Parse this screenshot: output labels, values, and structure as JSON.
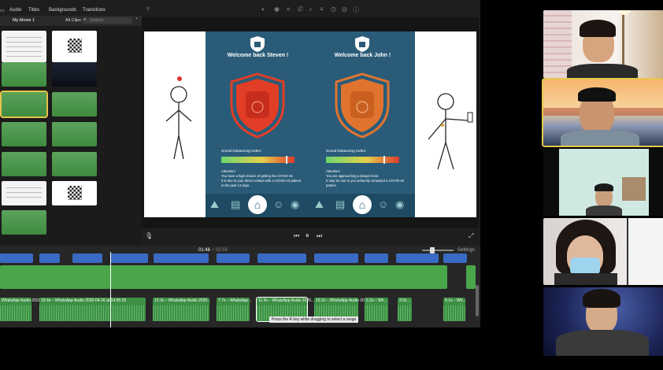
{
  "editor": {
    "tabs": [
      "Audio",
      "Titles",
      "Backgrounds",
      "Transitions"
    ],
    "library": {
      "project": "My Movie 1",
      "filter": "All Clips",
      "search_placeholder": "Search"
    },
    "viewer": {
      "screens": [
        {
          "greeting": "Welcome back Steven !",
          "sdi_label": "Social Distancing Index:",
          "note": "Attention!\nYou have a high chance of getting the COVID-19.\nIt is due to your direct contact with a COVID-19 patient in the past 14 days.",
          "shield_color": "#e23d26"
        },
        {
          "greeting": "Welcome back John !",
          "sdi_label": "Social Distancing Index:",
          "note": "Attention!\nYou are approaching a danger level.\nIt may be due to you indirectly contacted a COVID-19 patient.",
          "shield_color": "#e0742f"
        }
      ]
    },
    "controls": {
      "current_time": "01:46",
      "total_time": "02:58",
      "settings": "Settings"
    },
    "timeline": {
      "audio_clips": [
        "WhatsApp Audio 2020-...",
        "19.4s – WhatsApp Audio 2020-04-26 at 14.05.59",
        "13.3s – WhatsApp Audio 2020...",
        "7.7s – WhatsApp...",
        "11.9s – WhatsApp Audio 2020...",
        "10.2s – WhatsApp Audio 2020...",
        "5.2s – Wh...",
        "3.0s...",
        "4.1s – Wh..."
      ],
      "tooltip": "Press the R key while dragging to select a range"
    }
  },
  "call": {
    "participants": 5,
    "active_index": 1
  }
}
